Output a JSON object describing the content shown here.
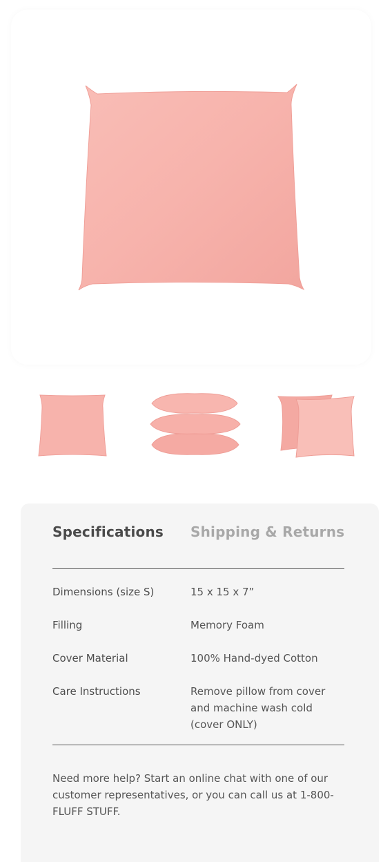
{
  "product": {
    "main_image": "pink-square-pillow",
    "pillow_color": "#f7b3ad",
    "thumbnails": [
      {
        "name": "single-pillow"
      },
      {
        "name": "stacked-pillows"
      },
      {
        "name": "two-pillows"
      }
    ]
  },
  "tabs": {
    "specifications": "Specifications",
    "shipping_returns": "Shipping & Returns",
    "active": "Specifications"
  },
  "specs": [
    {
      "label": "Dimensions (size S)",
      "value": "15 x 15 x 7”"
    },
    {
      "label": "Filling",
      "value": "Memory Foam"
    },
    {
      "label": "Cover Material",
      "value": "100% Hand-dyed Cotton"
    },
    {
      "label": "Care Instructions",
      "value": "Remove pillow from cover and machine wash cold (cover ONLY)"
    }
  ],
  "help": {
    "text": "Need more help? Start an online chat with one of our customer representatives, or you can call us at 1-800-FLUFF STUFF."
  }
}
